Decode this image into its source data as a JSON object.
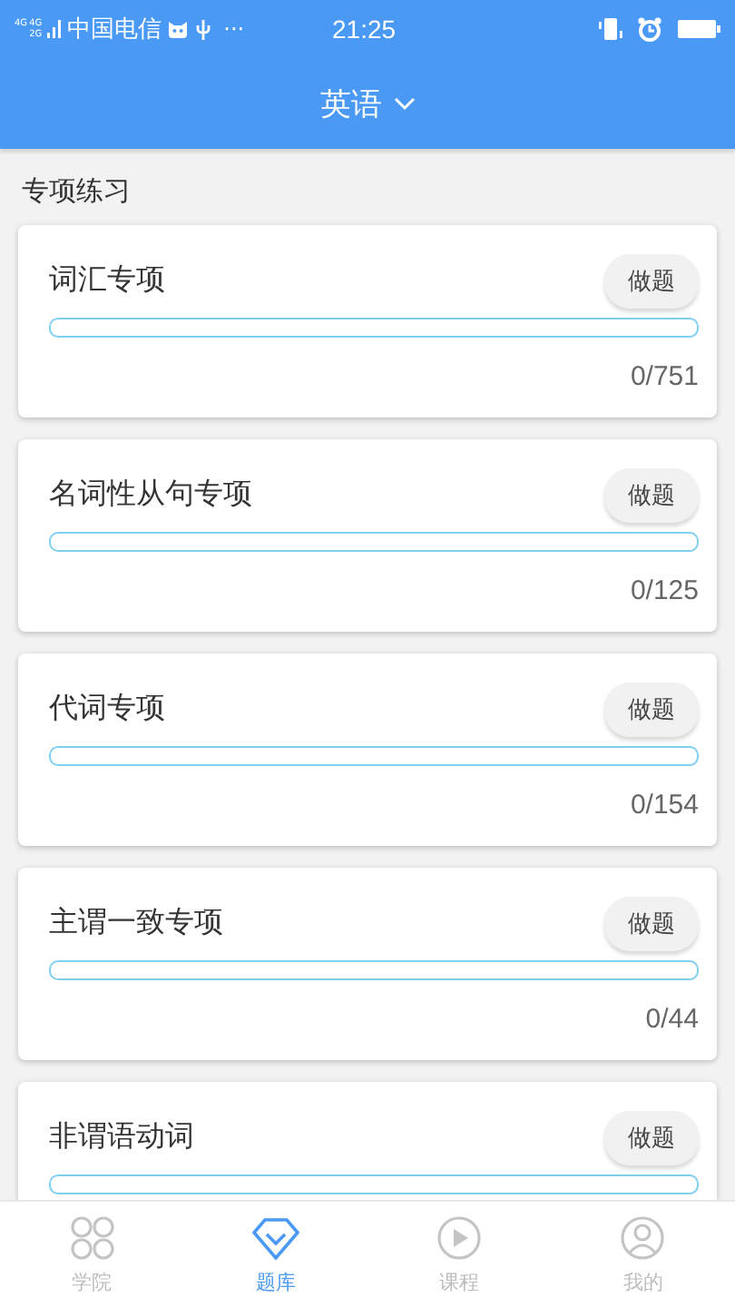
{
  "status_bar": {
    "network_labels": [
      "4G",
      "4G",
      "2G"
    ],
    "carrier": "中国电信",
    "more": "···",
    "time": "21:25"
  },
  "header": {
    "title": "英语"
  },
  "section_title": "专项练习",
  "topics": [
    {
      "name": "词汇专项",
      "button": "做题",
      "level": 0,
      "count": "0/751"
    },
    {
      "name": "名词性从句专项",
      "button": "做题",
      "level": 0,
      "count": "0/125"
    },
    {
      "name": "代词专项",
      "button": "做题",
      "level": 0,
      "count": "0/154"
    },
    {
      "name": "主谓一致专项",
      "button": "做题",
      "level": 0,
      "count": "0/44"
    },
    {
      "name": "非谓语动词",
      "button": "做题",
      "level": 0
    }
  ],
  "tabs": [
    {
      "label": "学院",
      "kind": "grid",
      "selected": false
    },
    {
      "label": "题库",
      "kind": "diamond",
      "selected": true
    },
    {
      "label": "课程",
      "kind": "play",
      "selected": false
    },
    {
      "label": "我的",
      "kind": "person",
      "selected": false
    }
  ]
}
